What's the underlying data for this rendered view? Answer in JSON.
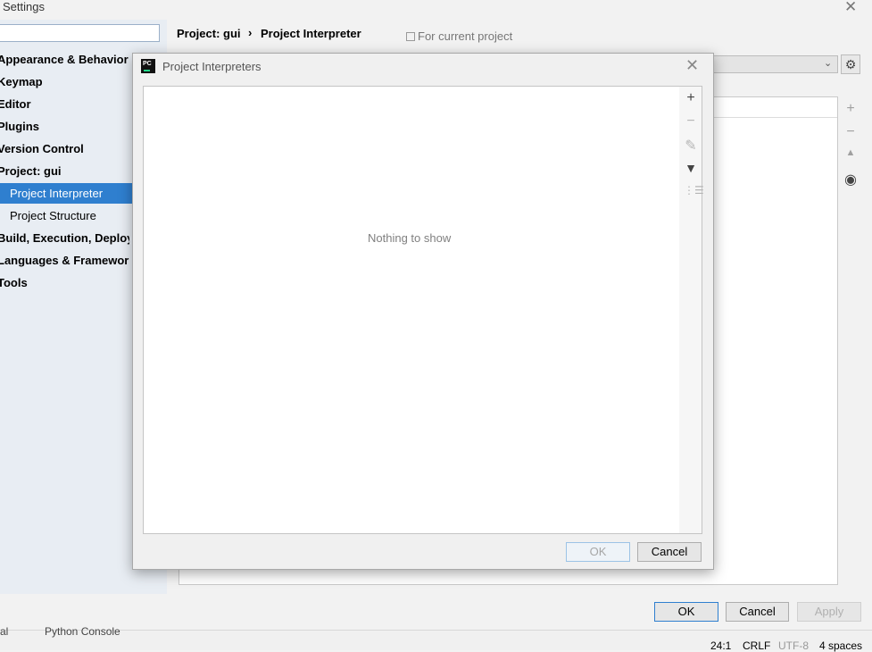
{
  "window": {
    "title": "Settings"
  },
  "sidebar": {
    "items": [
      {
        "label": "Appearance & Behavior"
      },
      {
        "label": "Keymap"
      },
      {
        "label": "Editor"
      },
      {
        "label": "Plugins"
      },
      {
        "label": "Version Control"
      },
      {
        "label": "Project: gui"
      },
      {
        "label": "Project Interpreter"
      },
      {
        "label": "Project Structure"
      },
      {
        "label": "Build, Execution, Deployment"
      },
      {
        "label": "Languages & Frameworks"
      },
      {
        "label": "Tools"
      }
    ]
  },
  "main": {
    "breadcrumb": [
      "Project: gui",
      "Project Interpreter"
    ],
    "for_current_project": "For current project",
    "buttons": {
      "ok": "OK",
      "cancel": "Cancel",
      "apply": "Apply"
    }
  },
  "status": {
    "tool_window": "Python Console",
    "left_fragment": "al",
    "position": "24:1",
    "line_sep": "CRLF",
    "encoding": "UTF-8",
    "indent": "4 spaces"
  },
  "dialog": {
    "title": "Project Interpreters",
    "empty_text": "Nothing to show",
    "buttons": {
      "ok": "OK",
      "cancel": "Cancel"
    }
  },
  "colors": {
    "selection": "#2f7fcf",
    "sidebar_bg": "#e8edf3"
  }
}
